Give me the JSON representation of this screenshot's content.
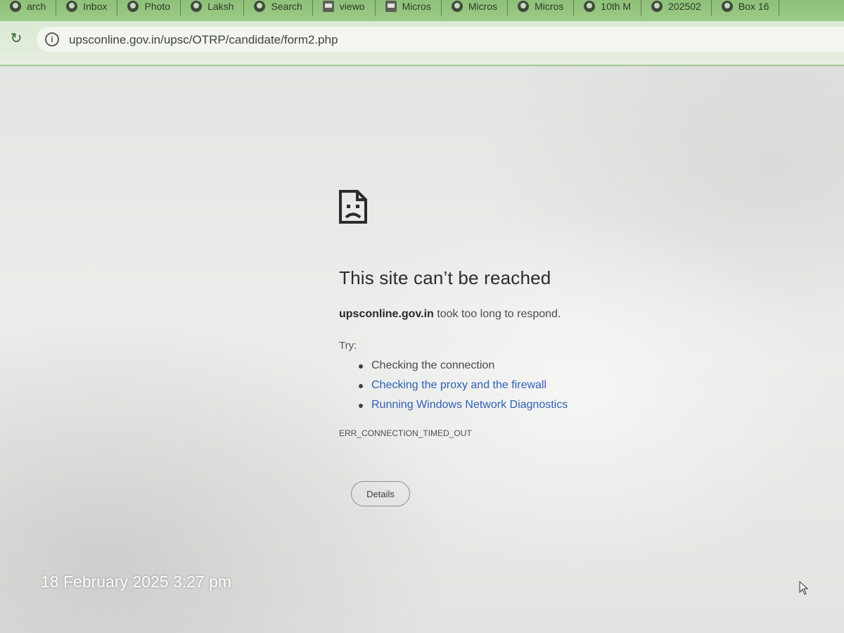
{
  "browser": {
    "tabs": [
      {
        "title": "arch",
        "icon": "globe-icon"
      },
      {
        "title": "Inbox",
        "icon": "globe-icon"
      },
      {
        "title": "Photo",
        "icon": "globe-icon"
      },
      {
        "title": "Laksh",
        "icon": "globe-icon"
      },
      {
        "title": "Search",
        "icon": "globe-icon"
      },
      {
        "title": "viewo",
        "icon": "document-icon"
      },
      {
        "title": "Micros",
        "icon": "document-icon"
      },
      {
        "title": "Micros",
        "icon": "globe-icon"
      },
      {
        "title": "Micros",
        "icon": "globe-icon"
      },
      {
        "title": "10th M",
        "icon": "globe-icon"
      },
      {
        "title": "202502",
        "icon": "globe-icon"
      },
      {
        "title": "Box 16",
        "icon": "globe-icon"
      }
    ],
    "address_bar": {
      "url": "upsconline.gov.in/upsc/OTRP/candidate/form2.php"
    }
  },
  "error_page": {
    "title": "This site can’t be reached",
    "host": "upsconline.gov.in",
    "message": " took too long to respond.",
    "try_label": "Try:",
    "suggestions": [
      {
        "text": "Checking the connection",
        "link": false
      },
      {
        "text": "Checking the proxy and the firewall",
        "link": true
      },
      {
        "text": "Running Windows Network Diagnostics",
        "link": true
      }
    ],
    "error_code": "ERR_CONNECTION_TIMED_OUT",
    "details_button": "Details"
  },
  "photo_overlay": {
    "timestamp": "18 February 2025 3:27 pm"
  },
  "colors": {
    "link": "#2f5fb5",
    "tab_strip": "#9bcb85",
    "toolbar": "#e6eee1"
  }
}
